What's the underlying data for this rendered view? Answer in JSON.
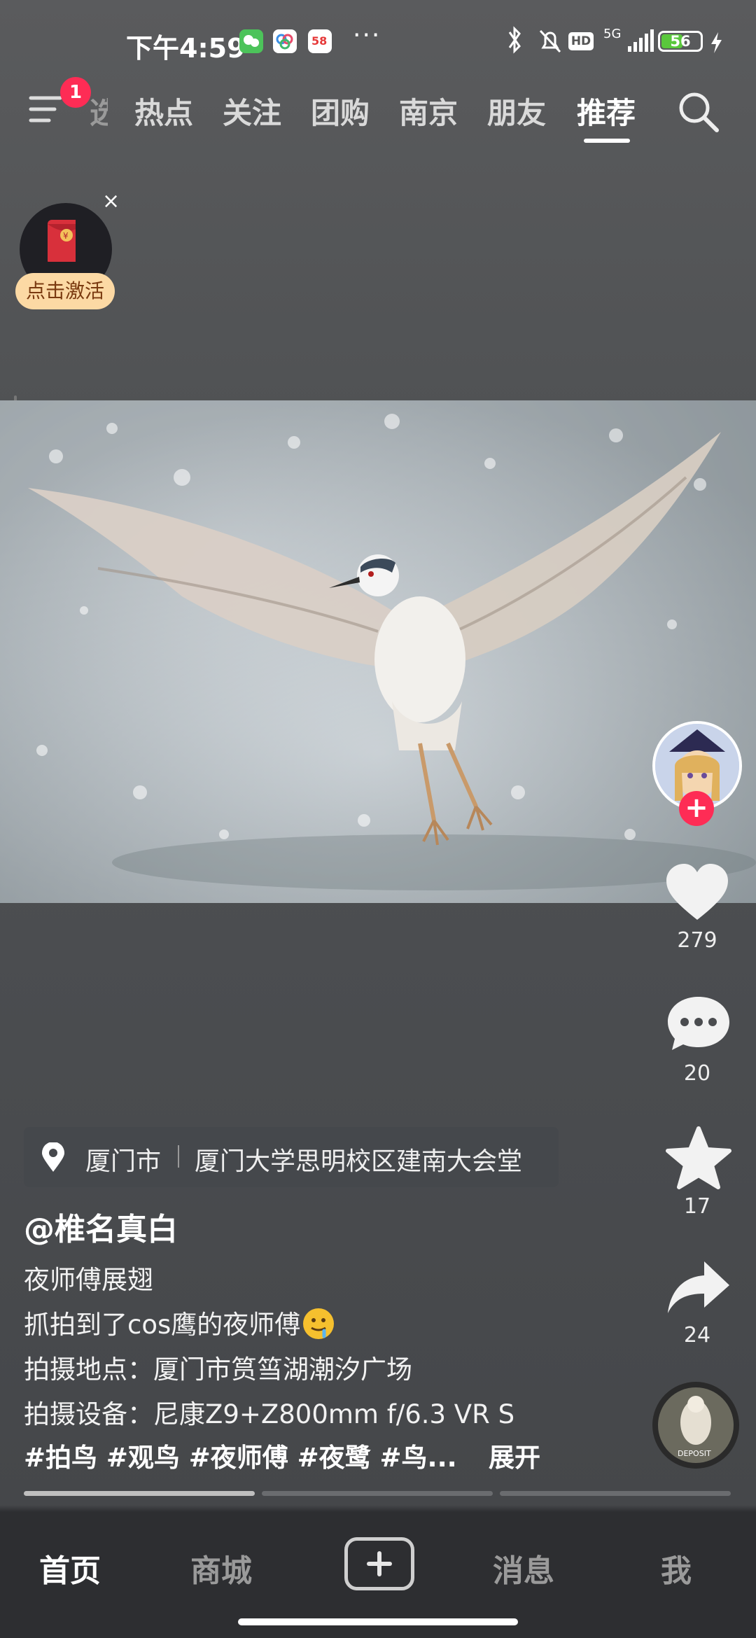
{
  "status_bar": {
    "time": "下午4:59",
    "network": "5G",
    "hd": "HD",
    "battery": "56",
    "battery_level": 0.56,
    "more": "···"
  },
  "top_nav": {
    "notification_count": "1",
    "partial_tab": "选",
    "tabs": [
      "热点",
      "关注",
      "团购",
      "南京",
      "朋友",
      "推荐"
    ],
    "active_tab": "推荐"
  },
  "promo": {
    "label": "点击激活",
    "close": "×",
    "envelope_symbol": "¥"
  },
  "post": {
    "location_city": "厦门市",
    "location_place": "厦门大学思明校区建南大会堂",
    "author": "@椎名真白",
    "lines": [
      "夜师傅展翅",
      "抓拍到了cos鹰的夜师傅",
      "拍摄地点：厦门市筼筜湖潮汐广场",
      "拍摄设备：尼康Z9+Z800mm f/6.3 VR S"
    ],
    "hashtags": "#拍鸟 #观鸟 #夜师傅 #夜鹭 #鸟...",
    "expand": "展开",
    "likes": "279",
    "comments": "20",
    "favorites": "17",
    "shares": "24",
    "music_disc_text": "DEPOSIT"
  },
  "bottom_nav": {
    "home": "首页",
    "mall": "商城",
    "messages": "消息",
    "me": "我"
  },
  "colors": {
    "accent": "#fe2c55",
    "battery_fill": "#5ac83c",
    "promo_bg": "#fcd9a4",
    "nav_bg": "#2d2e31"
  }
}
